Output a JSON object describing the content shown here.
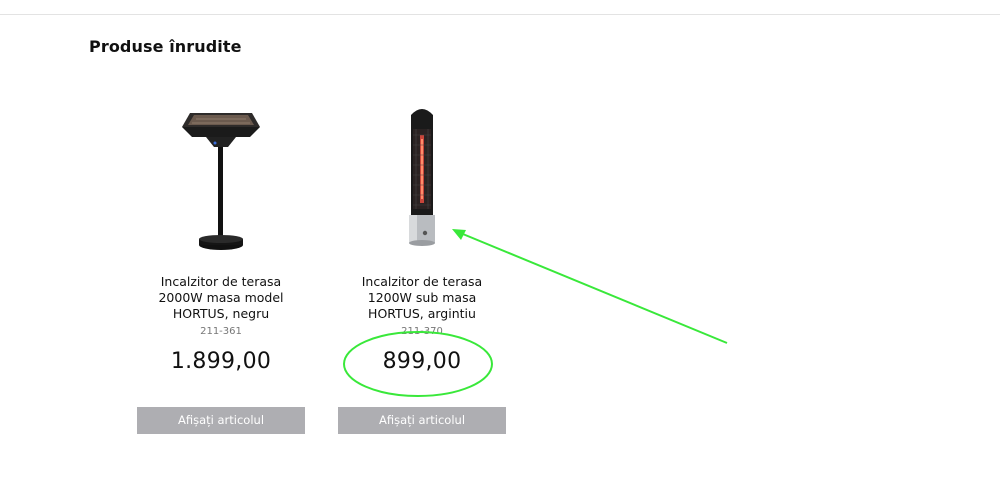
{
  "section": {
    "title": "Produse înrudite"
  },
  "products": [
    {
      "name": "Incalzitor de terasa 2000W masa model HORTUS, negru",
      "sku": "211-361",
      "price": "1.899,00",
      "button_label": "Afișați articolul",
      "image_icon": "table-patio-heater-icon"
    },
    {
      "name": "Incalzitor de terasa 1200W sub masa HORTUS, argintiu",
      "sku": "211-370",
      "price": "899,00",
      "button_label": "Afișați articolul",
      "image_icon": "tower-patio-heater-icon"
    }
  ],
  "colors": {
    "button_bg": "#aeaeb2",
    "annotation_green": "#39e83a"
  }
}
